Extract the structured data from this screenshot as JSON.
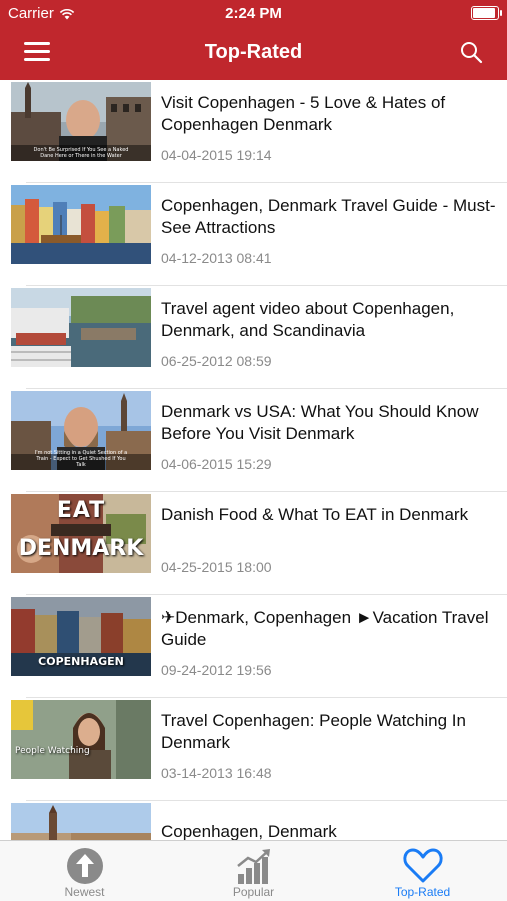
{
  "status_bar": {
    "carrier": "Carrier",
    "time": "2:24 PM"
  },
  "navbar": {
    "title": "Top-Rated"
  },
  "accent_color": "#c0272d",
  "videos": [
    {
      "title": "Visit Copenhagen - 5 Love & Hates of Copenhagen Denmark",
      "date": "04-04-2015 19:14",
      "thumb_caption": "Don't Be Surprised If You See a Naked Dane Here or There in the Water"
    },
    {
      "title": "Copenhagen, Denmark Travel Guide - Must-See Attractions",
      "date": "04-12-2013 08:41"
    },
    {
      "title": "Travel agent video about Copenhagen, Denmark, and Scandinavia",
      "date": "06-25-2012 08:59"
    },
    {
      "title": "Denmark vs USA: What You Should Know Before You Visit Denmark",
      "date": "04-06-2015 15:29",
      "thumb_caption": "I'm not Sitting in a Quiet Section of a Train - Expect to Get Shushed If You Talk"
    },
    {
      "title": "Danish Food & What To EAT in Denmark",
      "date": "04-25-2015 18:00",
      "thumb_word1": "EAT",
      "thumb_word2": "DENMARK"
    },
    {
      "title": "✈Denmark, Copenhagen ►Vacation Travel Guide",
      "date": "09-24-2012 19:56",
      "thumb_word": "COPENHAGEN"
    },
    {
      "title": "Travel Copenhagen: People Watching In Denmark",
      "date": "03-14-2013 16:48",
      "thumb_caption": "People Watching"
    },
    {
      "title": "Copenhagen, Denmark",
      "date": ""
    }
  ],
  "tabs": [
    {
      "label": "Newest",
      "icon": "up-arrow-circle-icon",
      "active": false
    },
    {
      "label": "Popular",
      "icon": "bar-chart-icon",
      "active": false
    },
    {
      "label": "Top-Rated",
      "icon": "heart-icon",
      "active": true
    }
  ],
  "active_tab_color": "#1a7cf5"
}
